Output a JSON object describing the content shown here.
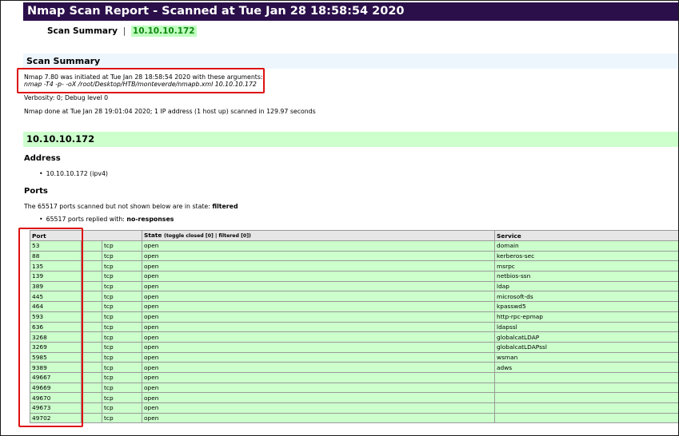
{
  "report": {
    "title": "Nmap Scan Report - Scanned at Tue Jan 28 18:58:54 2020",
    "summary_link_label": "Scan Summary",
    "summary_link_separator": "|",
    "host_link": "10.10.10.172"
  },
  "scan_summary": {
    "heading": "Scan Summary",
    "initiated": "Nmap 7.80 was initiated at Tue Jan 28 18:58:54 2020 with these arguments:",
    "arguments": "nmap -T4 -p- -oX /root/Desktop/HTB/monteverde/nmapb.xml 10.10.10.172",
    "verbosity": "Verbosity: 0; Debug level 0",
    "done": "Nmap done at Tue Jan 28 19:01:04 2020; 1 IP address (1 host up) scanned in 129.97 seconds"
  },
  "host": {
    "heading": "10.10.10.172",
    "address_heading": "Address",
    "address_item": "10.10.10.172 (ipv4)",
    "ports_heading": "Ports",
    "filtered_prefix": "The 65517 ports scanned but not shown below are in state: ",
    "filtered_state": "filtered",
    "replied_prefix": "65517 ports replied with: ",
    "replied_reason": "no-responses"
  },
  "ports_table": {
    "headers": {
      "port": "Port",
      "state": "State",
      "state_toggle": "(toggle closed [0] | filtered [0])",
      "service": "Service"
    },
    "rows": [
      {
        "port": "53",
        "proto": "tcp",
        "state": "open",
        "service": "domain"
      },
      {
        "port": "88",
        "proto": "tcp",
        "state": "open",
        "service": "kerberos-sec"
      },
      {
        "port": "135",
        "proto": "tcp",
        "state": "open",
        "service": "msrpc"
      },
      {
        "port": "139",
        "proto": "tcp",
        "state": "open",
        "service": "netbios-ssn"
      },
      {
        "port": "389",
        "proto": "tcp",
        "state": "open",
        "service": "ldap"
      },
      {
        "port": "445",
        "proto": "tcp",
        "state": "open",
        "service": "microsoft-ds"
      },
      {
        "port": "464",
        "proto": "tcp",
        "state": "open",
        "service": "kpasswd5"
      },
      {
        "port": "593",
        "proto": "tcp",
        "state": "open",
        "service": "http-rpc-epmap"
      },
      {
        "port": "636",
        "proto": "tcp",
        "state": "open",
        "service": "ldapssl"
      },
      {
        "port": "3268",
        "proto": "tcp",
        "state": "open",
        "service": "globalcatLDAP"
      },
      {
        "port": "3269",
        "proto": "tcp",
        "state": "open",
        "service": "globalcatLDAPssl"
      },
      {
        "port": "5985",
        "proto": "tcp",
        "state": "open",
        "service": "wsman"
      },
      {
        "port": "9389",
        "proto": "tcp",
        "state": "open",
        "service": "adws"
      },
      {
        "port": "49667",
        "proto": "tcp",
        "state": "open",
        "service": ""
      },
      {
        "port": "49669",
        "proto": "tcp",
        "state": "open",
        "service": ""
      },
      {
        "port": "49670",
        "proto": "tcp",
        "state": "open",
        "service": ""
      },
      {
        "port": "49673",
        "proto": "tcp",
        "state": "open",
        "service": ""
      },
      {
        "port": "49702",
        "proto": "tcp",
        "state": "open",
        "service": ""
      }
    ]
  },
  "colors": {
    "title_bar": "#2b0f4a",
    "open_row": "#ccffcc",
    "summary_band": "#eef6fd",
    "annotation_red": "#dd1111"
  }
}
